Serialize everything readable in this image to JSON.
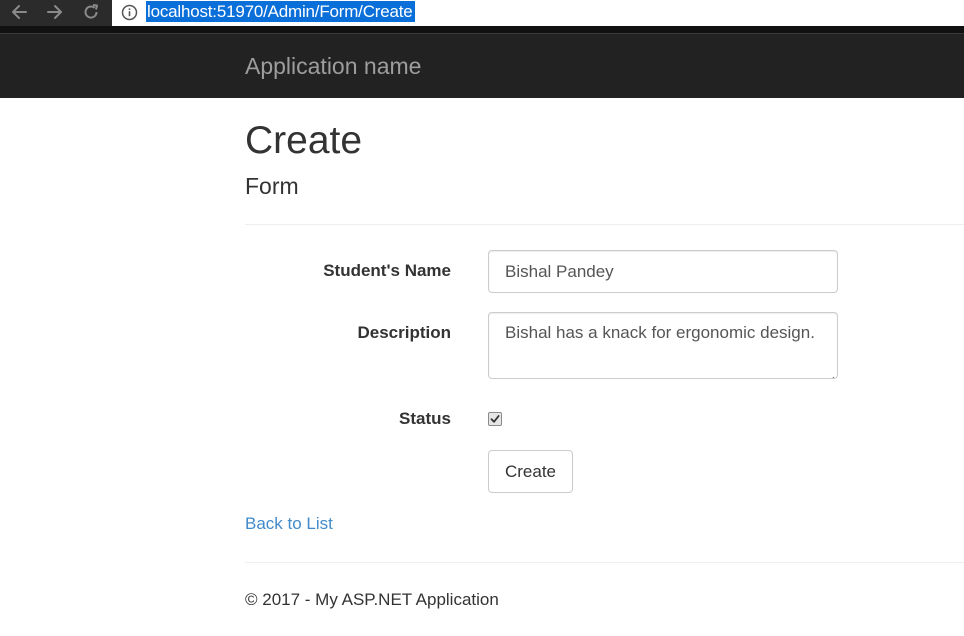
{
  "browser": {
    "url": "localhost:51970/Admin/Form/Create",
    "icons": [
      "back-arrow-icon",
      "forward-arrow-icon",
      "reload-icon",
      "info-icon"
    ]
  },
  "navbar": {
    "brand": "Application name"
  },
  "page": {
    "title": "Create",
    "subtitle": "Form"
  },
  "form": {
    "name_label": "Student's Name",
    "name_value": "Bishal Pandey",
    "description_label": "Description",
    "description_value": "Bishal has a knack for ergonomic design.",
    "status_label": "Status",
    "status_checked": true,
    "submit_label": "Create"
  },
  "links": {
    "back_to_list": "Back to List"
  },
  "footer": {
    "text": "© 2017 - My ASP.NET Application"
  },
  "colors": {
    "navbar_bg": "#222222",
    "brand_text": "#9d9d9d",
    "link": "#428bca",
    "url_highlight": "#0a6fd9"
  }
}
